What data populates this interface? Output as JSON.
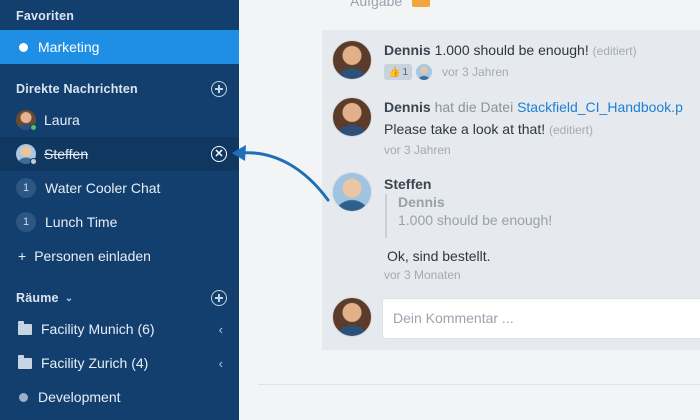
{
  "sidebar": {
    "favorites_title": "Favoriten",
    "favorites": [
      {
        "label": "Marketing"
      }
    ],
    "dm_title": "Direkte Nachrichten",
    "dms": [
      {
        "label": "Laura"
      },
      {
        "label": "Steffen"
      },
      {
        "label": "Water Cooler Chat",
        "badge": "1"
      },
      {
        "label": "Lunch Time",
        "badge": "1"
      }
    ],
    "invite_label": "Personen einladen",
    "invite_prefix": "+",
    "rooms_title": "Räume",
    "rooms": [
      {
        "label": "Facility Munich (6)"
      },
      {
        "label": "Facility Zurich (4)"
      },
      {
        "label": "Development"
      }
    ],
    "close_glyph": "✕",
    "chevron_left": "‹",
    "chevron_down": "⌄"
  },
  "main": {
    "top_item_label": "Aufgabe",
    "comments": [
      {
        "author": "Dennis",
        "text": "1.000 should be enough!",
        "edited": "(editiert)",
        "likes": "1",
        "time": "vor 3 Jahren"
      },
      {
        "author": "Dennis",
        "action": "hat die Datei",
        "file": "Stackfield_CI_Handbook.p",
        "text": "Please take a look at that!",
        "edited": "(editiert)",
        "time": "vor 3 Jahren"
      },
      {
        "author": "Steffen",
        "quote_author": "Dennis",
        "quote_text": "1.000 should be enough!",
        "text": "Ok, sind bestellt.",
        "time": "vor 3 Monaten"
      }
    ],
    "input_placeholder": "Dein Kommentar ..."
  },
  "colors": {
    "sidebar": "#123f6d",
    "active": "#1f8fe6",
    "link": "#1d7fd6",
    "arrow": "#1f6fb8"
  }
}
